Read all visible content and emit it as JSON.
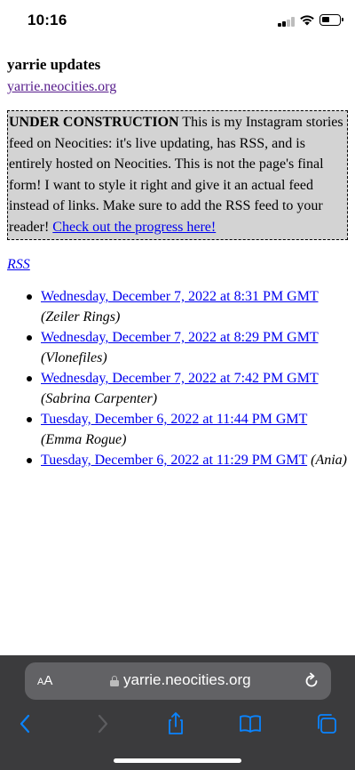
{
  "status_bar": {
    "time": "10:16"
  },
  "page": {
    "title": "yarrie updates",
    "site_link": "yarrie.neocities.org",
    "notice": {
      "heading": "UNDER CONSTRUCTION",
      "body": " This is my Instagram stories feed on Neocities: it's live updating, has RSS, and is entirely hosted on Neocities. This is not the page's final form! I want to style it right and give it an actual feed instead of links. Make sure to add the RSS feed to your reader! ",
      "link": "Check out the progress here!"
    },
    "rss_label": "RSS",
    "feed": [
      {
        "date": "Wednesday, December 7, 2022 at 8:31 PM GMT",
        "who": "(Zeiler Rings)"
      },
      {
        "date": "Wednesday, December 7, 2022 at 8:29 PM GMT",
        "who": "(Vlonefiles)"
      },
      {
        "date": "Wednesday, December 7, 2022 at 7:42 PM GMT",
        "who": "(Sabrina Carpenter)"
      },
      {
        "date": "Tuesday, December 6, 2022 at 11:44 PM GMT",
        "who": "(Emma Rogue)"
      },
      {
        "date": "Tuesday, December 6, 2022 at 11:29 PM GMT",
        "who": "(Ania)"
      }
    ]
  },
  "browser": {
    "text_size_small": "A",
    "text_size_large": "A",
    "url": "yarrie.neocities.org",
    "accent_color": "#0a84ff"
  }
}
